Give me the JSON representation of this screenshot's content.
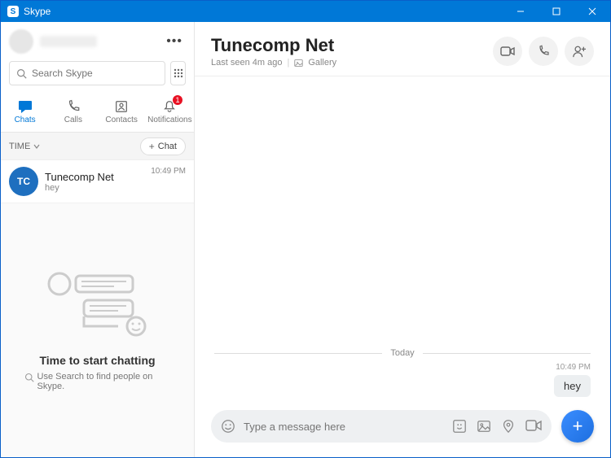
{
  "titlebar": {
    "app_name": "Skype"
  },
  "search": {
    "placeholder": "Search Skype"
  },
  "nav": {
    "chats": "Chats",
    "calls": "Calls",
    "contacts": "Contacts",
    "notifications": "Notifications",
    "notification_badge": "1"
  },
  "section": {
    "time_label": "TIME",
    "chat_btn": "Chat"
  },
  "conversations": [
    {
      "avatar_text": "TC",
      "name": "Tunecomp Net",
      "preview": "hey",
      "time": "10:49 PM"
    }
  ],
  "empty": {
    "title": "Time to start chatting",
    "subtitle": "Use Search to find people on Skype."
  },
  "chat_header": {
    "title": "Tunecomp Net",
    "status": "Last seen 4m ago",
    "gallery": "Gallery"
  },
  "chat": {
    "day_separator": "Today",
    "messages": [
      {
        "time": "10:49 PM",
        "text": "hey",
        "outgoing": true
      }
    ]
  },
  "composer": {
    "placeholder": "Type a message here"
  }
}
